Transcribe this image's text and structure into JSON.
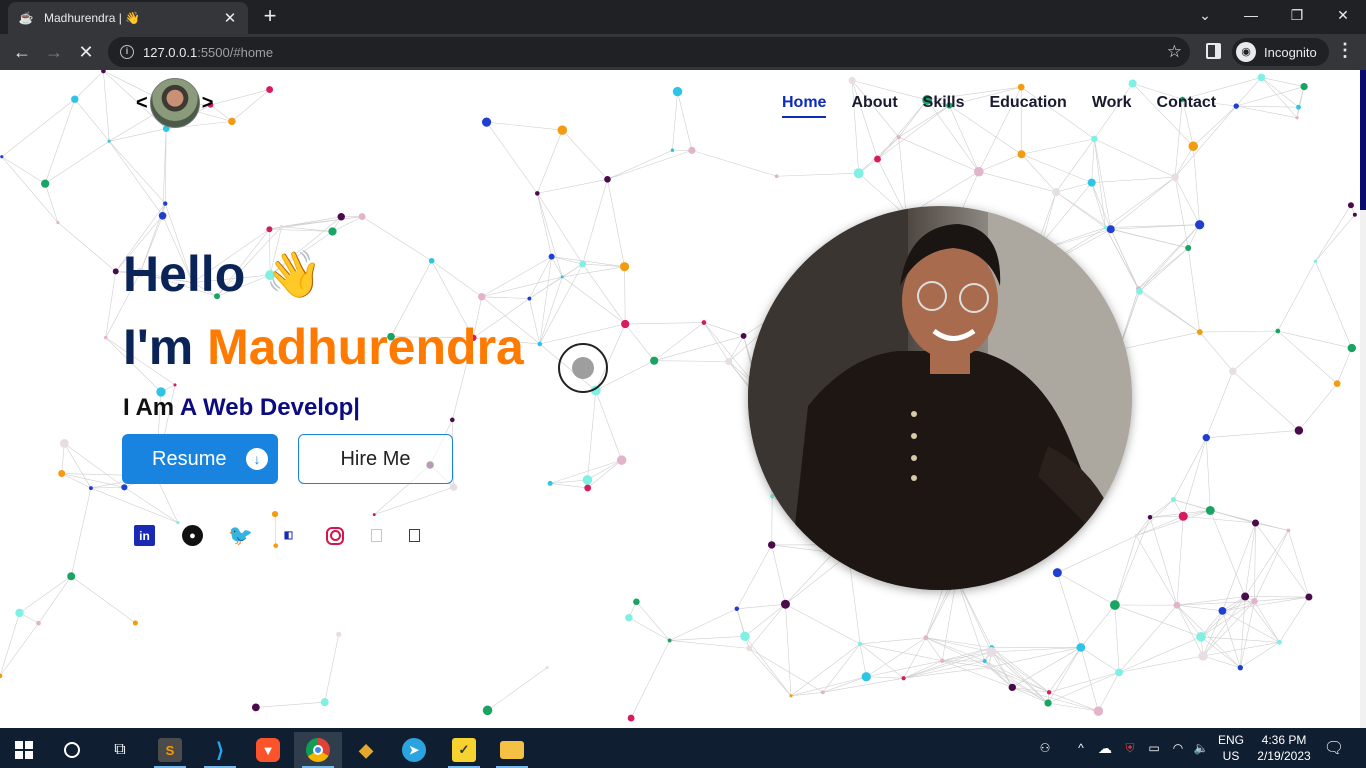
{
  "browser": {
    "tab_title": "Madhurendra | 👋",
    "url_host": "127.0.0.1",
    "url_path": ":5500/#home",
    "incognito_label": "Incognito"
  },
  "site": {
    "logo_left": "<",
    "logo_right": ">",
    "nav": [
      {
        "label": "Home",
        "active": true
      },
      {
        "label": "About"
      },
      {
        "label": "Skills"
      },
      {
        "label": "Education"
      },
      {
        "label": "Work"
      },
      {
        "label": "Contact"
      }
    ],
    "hero": {
      "hello": "Hello",
      "wave_emoji": "👋",
      "im_prefix": "I'm ",
      "name": "Madhurendra",
      "typed_prefix": "I Am ",
      "typed_role": "A Web Develop|",
      "resume_label": "Resume",
      "hire_label": "Hire Me"
    },
    "socials": [
      "linkedin-icon",
      "github-icon",
      "twitter-icon",
      "telegram-icon",
      "instagram-icon",
      "box-icon",
      "box-icon"
    ],
    "colors": {
      "primary": "#1984e0",
      "accent": "#ff7a00",
      "heading": "#0b2458",
      "nav_active": "#0f2bb8"
    }
  },
  "taskbar": {
    "lang_line1": "ENG",
    "lang_line2": "US",
    "time": "4:36 PM",
    "date": "2/19/2023"
  }
}
